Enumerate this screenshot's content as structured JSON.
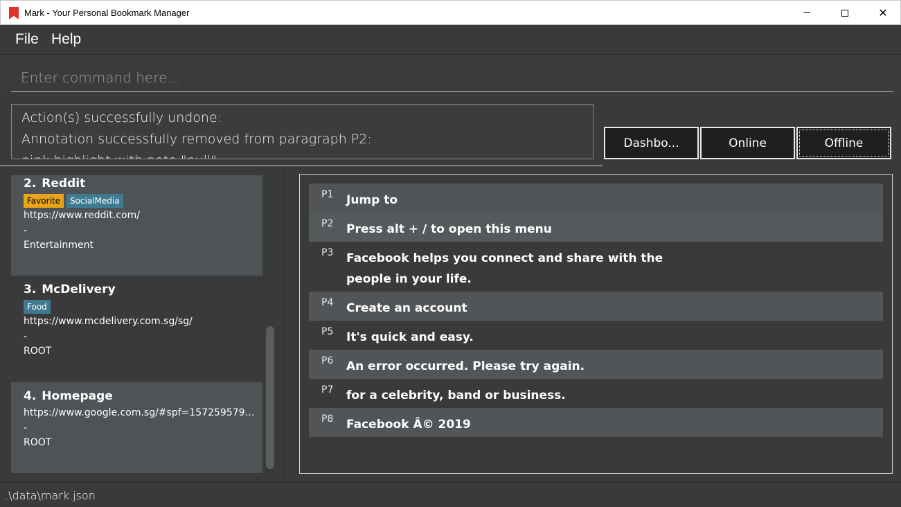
{
  "window": {
    "title": "Mark - Your Personal Bookmark Manager",
    "controls": {
      "minimize": "",
      "maximize": "",
      "close": "✕"
    }
  },
  "menu": {
    "items": [
      "File",
      "Help"
    ]
  },
  "command": {
    "placeholder": "Enter command here...",
    "value": ""
  },
  "result": {
    "lines": [
      "Action(s) successfully undone:",
      "Annotation successfully removed from paragraph P2:",
      "pink highlight with note \"null\""
    ]
  },
  "tabs": [
    {
      "label": "Dashbo..."
    },
    {
      "label": "Online"
    },
    {
      "label": "Offline"
    }
  ],
  "bookmarks": [
    {
      "index": "2.",
      "name": "Reddit",
      "tags": [
        "Favorite",
        "SocialMedia"
      ],
      "url": "https://www.reddit.com/",
      "remark": "-",
      "folder": "Entertainment"
    },
    {
      "index": "3.",
      "name": "McDelivery",
      "tags": [
        "Food"
      ],
      "url": "https://www.mcdelivery.com.sg/sg/",
      "remark": "-",
      "folder": "ROOT"
    },
    {
      "index": "4.",
      "name": "Homepage",
      "tags": [],
      "url": "https://www.google.com.sg/#spf=1572595792...",
      "remark": "-",
      "folder": "ROOT"
    }
  ],
  "paragraphs": [
    {
      "id": "P1",
      "text": "Jump to"
    },
    {
      "id": "P2",
      "text": "Press alt + / to open this menu"
    },
    {
      "id": "P3",
      "text": "Facebook helps you connect and share with the people in your life."
    },
    {
      "id": "P4",
      "text": "Create an account"
    },
    {
      "id": "P5",
      "text": "It's quick and easy."
    },
    {
      "id": "P6",
      "text": "An error occurred. Please try again."
    },
    {
      "id": "P7",
      "text": "for a celebrity, band or business."
    },
    {
      "id": "P8",
      "text": "Facebook Â© 2019"
    }
  ],
  "status": {
    "file_path": ".\\data\\mark.json"
  },
  "colors": {
    "background": "#3a3a3a",
    "tag_favorite": "#e8a317",
    "tag_default": "#3e7b91",
    "card_highlight": "#4d5356",
    "paragraph_highlight": "#515558",
    "app_icon": "#e0322b"
  }
}
